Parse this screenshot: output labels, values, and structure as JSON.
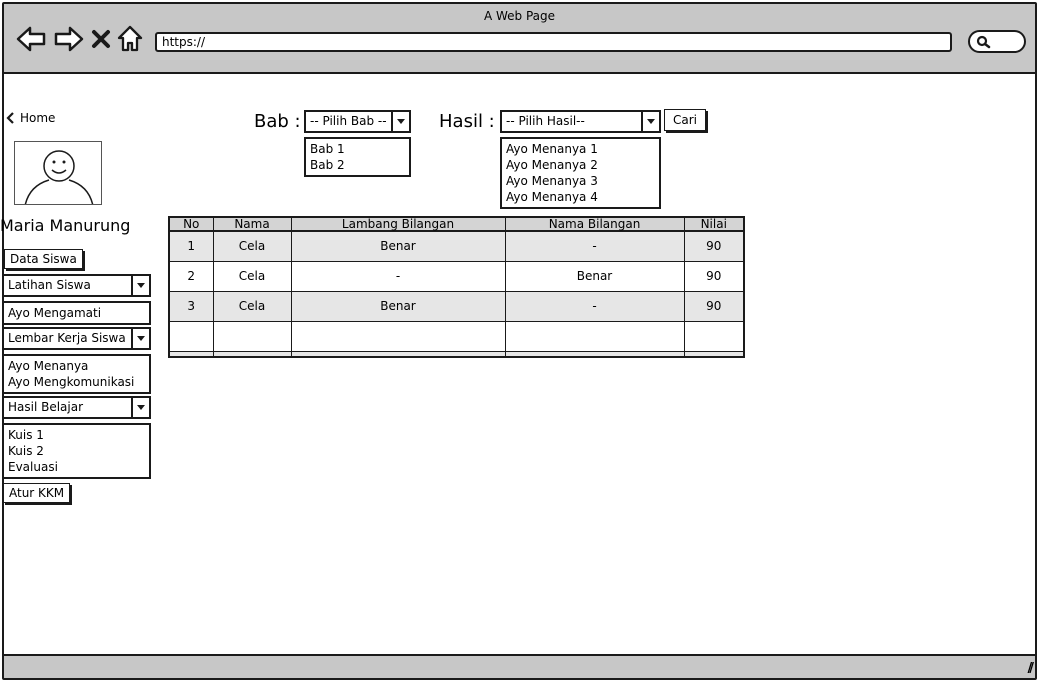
{
  "window": {
    "title": "A Web Page",
    "url": "https://"
  },
  "sidebar": {
    "home_label": "Home",
    "user_name": "Maria Manurung",
    "data_siswa": "Data Siswa",
    "latihan": {
      "label": "Latihan Siswa",
      "items": [
        "Ayo Mengamati"
      ]
    },
    "lembar": {
      "label": "Lembar Kerja Siswa",
      "items": [
        "Ayo Menanya",
        "Ayo Mengkomunikasi"
      ]
    },
    "hasil_belajar": {
      "label": "Hasil Belajar",
      "items": [
        "Kuis 1",
        "Kuis 2",
        "Evaluasi"
      ]
    },
    "atur_kkm": "Atur KKM"
  },
  "filter": {
    "bab_label": "Bab :",
    "bab_select": "-- Pilih Bab --",
    "bab_options": [
      "Bab 1",
      "Bab 2"
    ],
    "hasil_label": "Hasil :",
    "hasil_select": "-- Pilih Hasil--",
    "hasil_options": [
      "Ayo Menanya 1",
      "Ayo Menanya 2",
      "Ayo Menanya 3",
      "Ayo Menanya 4"
    ],
    "search_button": "Cari"
  },
  "table": {
    "headers": [
      "No",
      "Nama",
      "Lambang Bilangan",
      "Nama Bilangan",
      "Nilai"
    ],
    "rows": [
      [
        "1",
        "Cela",
        "Benar",
        "-",
        "90"
      ],
      [
        "2",
        "Cela",
        "-",
        "Benar",
        "90"
      ],
      [
        "3",
        "Cela",
        "Benar",
        "-",
        "90"
      ]
    ]
  },
  "colors": {
    "chrome": "#c7c7c7",
    "border": "#1a1a1a",
    "row_alt": "#e6e6e6",
    "header_bg": "#d4d4d4"
  }
}
